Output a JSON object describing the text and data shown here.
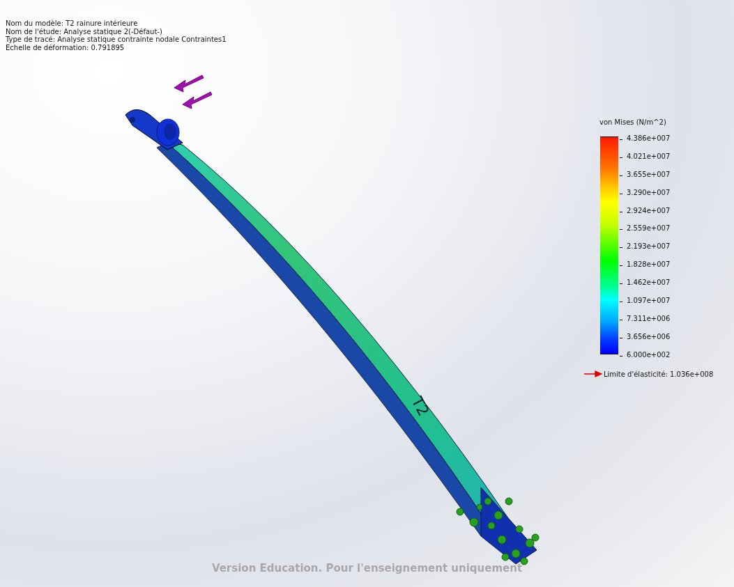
{
  "info": [
    "Nom du modèle: T2 rainure intérieure",
    "Nom de l'étude: Analyse statique 2(-Défaut-)",
    "Type de tracé: Analyse statique contrainte nodale Contraintes1",
    "Echelle de déformation: 0.791895"
  ],
  "model_label": "T2",
  "legend": {
    "title": "von Mises (N/m^2)",
    "labels": [
      "4.386e+007",
      "4.021e+007",
      "3.655e+007",
      "3.290e+007",
      "2.924e+007",
      "2.559e+007",
      "2.193e+007",
      "1.828e+007",
      "1.462e+007",
      "1.097e+007",
      "7.311e+006",
      "3.656e+006",
      "6.000e+002"
    ],
    "yield_limit": "Limite d'élasticité: 1.036e+008"
  },
  "watermark_text": "Version Education. Pour l'enseignement uniquement"
}
